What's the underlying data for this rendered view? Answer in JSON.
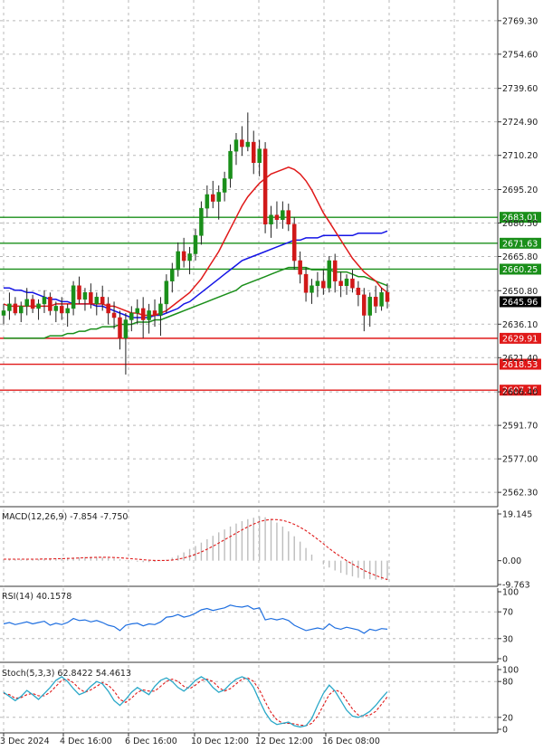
{
  "chart_data": [
    {
      "type": "candlestick",
      "x_tick_labels": [
        "3 Dec 2024",
        "4 Dec 16:00",
        "6 Dec 16:00",
        "10 Dec 12:00",
        "12 Dec 12:00",
        "16 Dec 08:00"
      ],
      "y_tick_labels": [
        "2769.30",
        "2754.60",
        "2739.60",
        "2724.90",
        "2710.20",
        "2695.20",
        "2680.50",
        "2665.80",
        "2650.80",
        "2636.10",
        "2621.40",
        "2606.40",
        "2591.70",
        "2577.00",
        "2562.30"
      ],
      "ylim": [
        2556,
        2776
      ],
      "current_price": {
        "label": "2645.96",
        "value": 2645.96
      },
      "levels": [
        {
          "label": "2683.01",
          "value": 2683.01,
          "color": "#1a8f1a"
        },
        {
          "label": "2671.63",
          "value": 2671.63,
          "color": "#1a8f1a"
        },
        {
          "label": "2660.25",
          "value": 2660.25,
          "color": "#1a8f1a"
        },
        {
          "label": "2629.91",
          "value": 2629.91,
          "color": "#e01919"
        },
        {
          "label": "2618.53",
          "value": 2618.53,
          "color": "#e01919"
        },
        {
          "label": "2607.15",
          "value": 2607.15,
          "color": "#e01919"
        }
      ],
      "candles": [
        [
          2640,
          2645,
          2636,
          2642
        ],
        [
          2642,
          2650,
          2638,
          2645
        ],
        [
          2645,
          2648,
          2640,
          2641
        ],
        [
          2641,
          2646,
          2637,
          2644
        ],
        [
          2644,
          2652,
          2640,
          2647
        ],
        [
          2647,
          2649,
          2641,
          2643
        ],
        [
          2643,
          2647,
          2638,
          2645
        ],
        [
          2645,
          2651,
          2641,
          2648
        ],
        [
          2648,
          2650,
          2640,
          2642
        ],
        [
          2642,
          2646,
          2637,
          2644
        ],
        [
          2644,
          2648,
          2638,
          2641
        ],
        [
          2641,
          2645,
          2635,
          2643
        ],
        [
          2643,
          2655,
          2640,
          2653
        ],
        [
          2653,
          2657,
          2645,
          2647
        ],
        [
          2647,
          2652,
          2642,
          2650
        ],
        [
          2650,
          2654,
          2643,
          2645
        ],
        [
          2645,
          2650,
          2640,
          2648
        ],
        [
          2648,
          2653,
          2642,
          2645
        ],
        [
          2645,
          2648,
          2636,
          2641
        ],
        [
          2641,
          2646,
          2634,
          2639
        ],
        [
          2639,
          2642,
          2625,
          2630
        ],
        [
          2630,
          2641,
          2614,
          2638
        ],
        [
          2638,
          2644,
          2633,
          2641
        ],
        [
          2641,
          2647,
          2636,
          2643
        ],
        [
          2643,
          2648,
          2630,
          2638
        ],
        [
          2638,
          2645,
          2632,
          2642
        ],
        [
          2642,
          2647,
          2635,
          2640
        ],
        [
          2640,
          2648,
          2631,
          2645
        ],
        [
          2645,
          2658,
          2641,
          2655
        ],
        [
          2655,
          2663,
          2650,
          2660
        ],
        [
          2660,
          2672,
          2657,
          2668
        ],
        [
          2668,
          2674,
          2661,
          2664
        ],
        [
          2664,
          2670,
          2658,
          2667
        ],
        [
          2667,
          2678,
          2664,
          2675
        ],
        [
          2675,
          2690,
          2671,
          2687
        ],
        [
          2687,
          2697,
          2683,
          2693
        ],
        [
          2693,
          2699,
          2687,
          2690
        ],
        [
          2690,
          2697,
          2682,
          2694
        ],
        [
          2694,
          2703,
          2690,
          2700
        ],
        [
          2700,
          2715,
          2696,
          2712
        ],
        [
          2712,
          2720,
          2706,
          2717
        ],
        [
          2717,
          2723,
          2710,
          2714
        ],
        [
          2714,
          2729,
          2712,
          2716
        ],
        [
          2716,
          2721,
          2702,
          2707
        ],
        [
          2707,
          2717,
          2701,
          2713
        ],
        [
          2713,
          2716,
          2676,
          2680
        ],
        [
          2680,
          2688,
          2674,
          2684
        ],
        [
          2684,
          2690,
          2678,
          2682
        ],
        [
          2682,
          2690,
          2678,
          2686
        ],
        [
          2686,
          2689,
          2677,
          2680
        ],
        [
          2680,
          2683,
          2660,
          2664
        ],
        [
          2664,
          2668,
          2654,
          2658
        ],
        [
          2658,
          2661,
          2646,
          2650
        ],
        [
          2650,
          2656,
          2645,
          2653
        ],
        [
          2653,
          2659,
          2648,
          2655
        ],
        [
          2655,
          2660,
          2649,
          2652
        ],
        [
          2652,
          2666,
          2650,
          2664
        ],
        [
          2664,
          2667,
          2650,
          2655
        ],
        [
          2655,
          2659,
          2648,
          2653
        ],
        [
          2653,
          2658,
          2649,
          2656
        ],
        [
          2656,
          2660,
          2650,
          2652
        ],
        [
          2652,
          2655,
          2644,
          2649
        ],
        [
          2649,
          2652,
          2633,
          2640
        ],
        [
          2640,
          2650,
          2635,
          2648
        ],
        [
          2648,
          2653,
          2641,
          2644
        ],
        [
          2644,
          2652,
          2642,
          2650
        ],
        [
          2650,
          2654,
          2643,
          2646
        ]
      ],
      "ma_red": [
        2645,
        2644,
        2644,
        2644,
        2644,
        2644,
        2644,
        2644,
        2644,
        2645,
        2645,
        2645,
        2645,
        2645,
        2645,
        2645,
        2645,
        2645,
        2644,
        2644,
        2643,
        2642,
        2641,
        2641,
        2640,
        2640,
        2640,
        2641,
        2642,
        2644,
        2646,
        2648,
        2650,
        2653,
        2656,
        2660,
        2664,
        2668,
        2673,
        2678,
        2683,
        2688,
        2692,
        2695,
        2698,
        2700,
        2702,
        2703,
        2704,
        2705,
        2704,
        2702,
        2699,
        2695,
        2690,
        2685,
        2681,
        2677,
        2673,
        2669,
        2665,
        2662,
        2659,
        2657,
        2655,
        2652,
        2650
      ],
      "ma_blue": [
        2652,
        2652,
        2651,
        2651,
        2650,
        2650,
        2649,
        2648,
        2647,
        2647,
        2646,
        2646,
        2645,
        2645,
        2645,
        2645,
        2644,
        2644,
        2643,
        2642,
        2641,
        2640,
        2639,
        2639,
        2639,
        2639,
        2640,
        2640,
        2641,
        2642,
        2643,
        2645,
        2646,
        2648,
        2650,
        2652,
        2654,
        2656,
        2658,
        2660,
        2662,
        2664,
        2665,
        2666,
        2667,
        2668,
        2669,
        2670,
        2671,
        2672,
        2673,
        2673,
        2674,
        2674,
        2674,
        2675,
        2675,
        2675,
        2675,
        2675,
        2675,
        2676,
        2676,
        2676,
        2676,
        2676,
        2677
      ],
      "ma_green": [
        2630,
        2630,
        2630,
        2630,
        2630,
        2630,
        2630,
        2630,
        2631,
        2631,
        2631,
        2632,
        2632,
        2633,
        2633,
        2634,
        2634,
        2635,
        2635,
        2635,
        2636,
        2636,
        2636,
        2637,
        2637,
        2637,
        2638,
        2638,
        2639,
        2640,
        2641,
        2642,
        2643,
        2644,
        2645,
        2646,
        2647,
        2648,
        2649,
        2650,
        2651,
        2653,
        2654,
        2655,
        2656,
        2657,
        2658,
        2659,
        2660,
        2661,
        2661,
        2661,
        2661,
        2660,
        2660,
        2660,
        2660,
        2659,
        2659,
        2659,
        2658,
        2657,
        2657,
        2656,
        2655,
        2654,
        2653
      ]
    },
    {
      "type": "bar",
      "label": "MACD(12,26,9) -7.854 -7.750",
      "y_tick_labels": [
        "19.145",
        "0.00",
        "-9.763"
      ],
      "ylim": [
        -10.5,
        21
      ],
      "histogram": [
        0.6,
        0.7,
        0.6,
        0.5,
        0.5,
        0.6,
        0.7,
        0.8,
        0.9,
        1.0,
        1.1,
        1.2,
        1.3,
        1.4,
        1.5,
        1.6,
        1.5,
        1.3,
        1.1,
        0.9,
        0.6,
        0.2,
        -0.1,
        -0.4,
        -0.6,
        -0.6,
        -0.5,
        -0.2,
        0.4,
        1.2,
        2.2,
        3.4,
        4.8,
        6.0,
        7.4,
        8.8,
        10.2,
        11.6,
        12.8,
        14.0,
        15.2,
        16.2,
        17.0,
        17.6,
        18.2,
        17.8,
        16.8,
        15.6,
        14.0,
        12.0,
        10.0,
        7.8,
        5.2,
        2.5,
        0.0,
        -1.5,
        -2.8,
        -4.0,
        -5.0,
        -5.8,
        -6.4,
        -7.0,
        -7.4,
        -7.6,
        -7.8,
        -7.8,
        -7.85
      ],
      "signal": [
        0.6,
        0.6,
        0.6,
        0.6,
        0.6,
        0.6,
        0.6,
        0.7,
        0.7,
        0.8,
        0.8,
        0.9,
        1.0,
        1.1,
        1.2,
        1.3,
        1.4,
        1.4,
        1.4,
        1.3,
        1.2,
        1.0,
        0.8,
        0.6,
        0.4,
        0.2,
        0.1,
        0.1,
        0.1,
        0.3,
        0.6,
        1.1,
        1.8,
        2.6,
        3.6,
        4.7,
        5.9,
        7.2,
        8.6,
        9.9,
        11.3,
        12.6,
        13.9,
        15.0,
        16.0,
        16.6,
        16.9,
        16.8,
        16.5,
        15.8,
        14.9,
        13.7,
        12.3,
        10.6,
        8.8,
        6.9,
        5.0,
        3.2,
        1.6,
        0.0,
        -1.4,
        -2.7,
        -4.0,
        -5.1,
        -6.1,
        -6.9,
        -7.75
      ]
    },
    {
      "type": "line",
      "label": "RSI(14) 40.1578",
      "y_tick_labels": [
        "100",
        "70",
        "30",
        "0"
      ],
      "ylim": [
        0,
        100
      ],
      "values": [
        52,
        54,
        51,
        53,
        55,
        52,
        54,
        56,
        50,
        53,
        51,
        54,
        60,
        57,
        58,
        55,
        57,
        54,
        50,
        48,
        42,
        50,
        52,
        53,
        49,
        52,
        51,
        55,
        62,
        63,
        66,
        62,
        64,
        68,
        73,
        75,
        72,
        74,
        76,
        80,
        78,
        77,
        79,
        74,
        76,
        58,
        60,
        58,
        60,
        57,
        50,
        46,
        42,
        44,
        46,
        44,
        52,
        46,
        44,
        47,
        45,
        43,
        38,
        44,
        42,
        45,
        44
      ],
      "color": "#1f6fe0"
    },
    {
      "type": "line",
      "label": "Stoch(5,3,3) 62.8422 54.4613",
      "y_tick_labels": [
        "100",
        "80",
        "20",
        "0"
      ],
      "ylim": [
        0,
        100
      ],
      "main": [
        62,
        55,
        48,
        55,
        65,
        58,
        50,
        60,
        70,
        82,
        88,
        80,
        68,
        58,
        62,
        72,
        80,
        76,
        64,
        48,
        40,
        50,
        62,
        70,
        64,
        58,
        72,
        82,
        86,
        80,
        70,
        64,
        72,
        82,
        88,
        82,
        70,
        62,
        66,
        76,
        84,
        88,
        84,
        70,
        48,
        28,
        14,
        8,
        10,
        12,
        6,
        4,
        6,
        18,
        40,
        60,
        74,
        64,
        48,
        32,
        22,
        20,
        24,
        30,
        40,
        52,
        62.84
      ],
      "signal": [
        60,
        58,
        52,
        53,
        58,
        60,
        56,
        56,
        62,
        72,
        82,
        84,
        78,
        68,
        62,
        66,
        72,
        78,
        74,
        64,
        50,
        45,
        52,
        62,
        66,
        64,
        64,
        72,
        80,
        84,
        80,
        72,
        68,
        74,
        82,
        84,
        80,
        70,
        64,
        68,
        76,
        84,
        86,
        80,
        66,
        46,
        28,
        16,
        10,
        10,
        9,
        7,
        6,
        10,
        22,
        40,
        58,
        66,
        62,
        48,
        34,
        24,
        22,
        24,
        30,
        42,
        54.46
      ]
    }
  ]
}
